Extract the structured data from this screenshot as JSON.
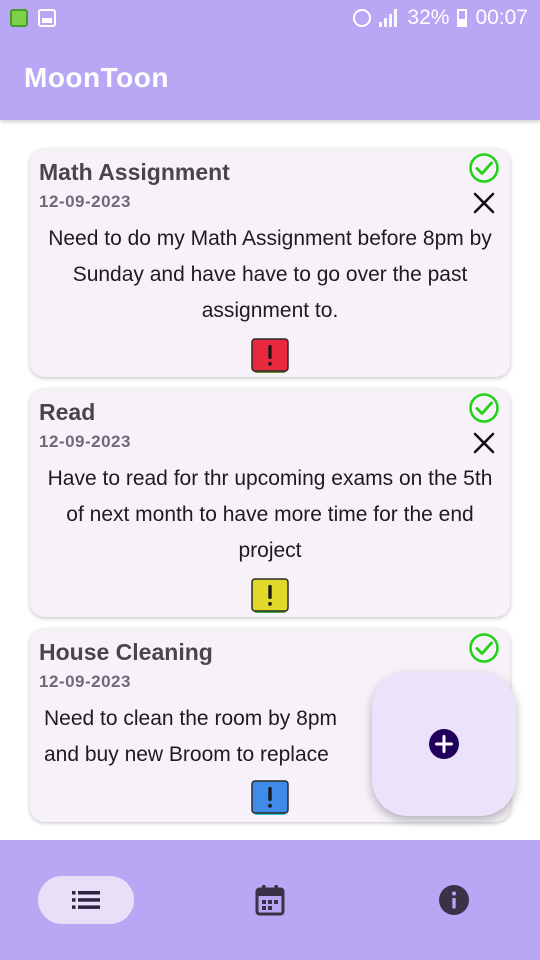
{
  "status_bar": {
    "battery": "32%",
    "time": "00:07"
  },
  "app": {
    "title": "MoonToon"
  },
  "tasks": [
    {
      "title": "Math Assignment",
      "date": "12-09-2023",
      "description": "Need to do my Math Assignment before 8pm by Sunday and have have to go over the past assignment to.",
      "priority": "high",
      "priority_color": "#e8283c",
      "priority_edge": "#6a8c2a"
    },
    {
      "title": "Read",
      "date": "12-09-2023",
      "description": "Have to read for thr upcoming exams on the 5th of next month to have more time for the end project",
      "priority": "medium",
      "priority_color": "#e0d92a",
      "priority_edge": "#3fae3a"
    },
    {
      "title": "House Cleaning",
      "date": "12-09-2023",
      "description": "Need to clean the room by 8pm and buy new Broom to replace",
      "priority": "low",
      "priority_color": "#3f8be8",
      "priority_edge": "#2ec4c4"
    }
  ],
  "colors": {
    "accent": "#b8a7f5",
    "check": "#22d31a",
    "fab_icon": "#21005d"
  },
  "icons": {
    "complete": "check-circle-icon",
    "delete": "close-icon",
    "priority": "exclamation-icon",
    "add": "add-circle-icon",
    "list": "list-icon",
    "calendar": "calendar-icon",
    "info": "info-icon"
  }
}
